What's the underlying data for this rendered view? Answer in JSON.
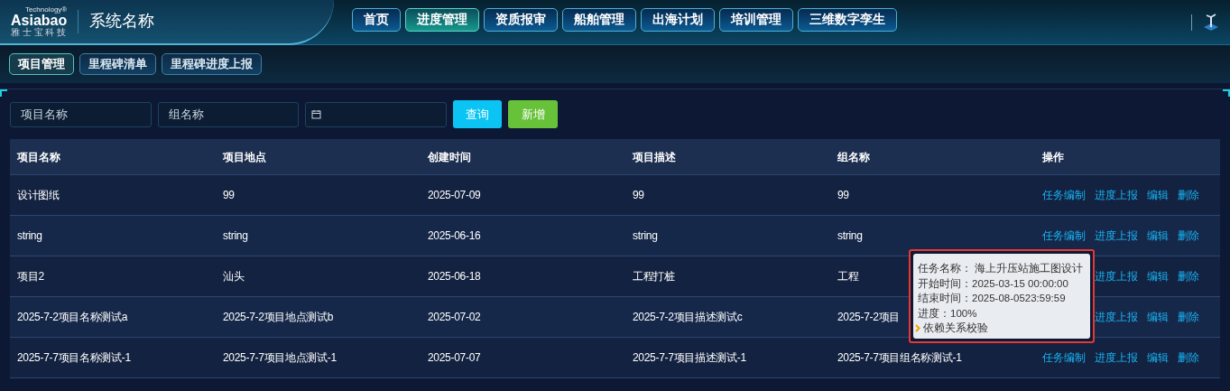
{
  "logo": {
    "brand": "Asiabao",
    "tagline": "Technology®",
    "subtitle": "雅 士 宝 科 技"
  },
  "system_name": "系统名称",
  "nav": [
    {
      "label": "首页",
      "selected": false
    },
    {
      "label": "进度管理",
      "selected": true
    },
    {
      "label": "资质报审",
      "selected": false
    },
    {
      "label": "船舶管理",
      "selected": false
    },
    {
      "label": "出海计划",
      "selected": false
    },
    {
      "label": "培训管理",
      "selected": false
    },
    {
      "label": "三维数字孪生",
      "selected": false
    }
  ],
  "sub_tabs": [
    {
      "label": "项目管理",
      "selected": true
    },
    {
      "label": "里程碑清单",
      "selected": false
    },
    {
      "label": "里程碑进度上报",
      "selected": false
    }
  ],
  "filters": {
    "project_name": {
      "placeholder": "项目名称"
    },
    "group_name": {
      "placeholder": "组名称"
    },
    "query_button": "查询",
    "add_button": "新增"
  },
  "table": {
    "columns": [
      "项目名称",
      "项目地点",
      "创建时间",
      "项目描述",
      "组名称",
      "操作"
    ],
    "rows": [
      {
        "cells": [
          "设计图纸",
          "99",
          "2025-07-09",
          "99",
          "99"
        ],
        "actions": [
          "任务编制",
          "进度上报",
          "编辑",
          "删除"
        ]
      },
      {
        "cells": [
          "string",
          "string",
          "2025-06-16",
          "string",
          "string"
        ],
        "actions": [
          "任务编制",
          "进度上报",
          "编辑",
          "删除"
        ]
      },
      {
        "cells": [
          "项目2",
          "汕头",
          "2025-06-18",
          "工程打桩",
          "工程"
        ],
        "actions": [
          "进度上报",
          "编辑",
          "删除"
        ]
      },
      {
        "cells": [
          "2025-7-2项目名称测试a",
          "2025-7-2项目地点测试b",
          "2025-07-02",
          "2025-7-2项目描述测试c",
          "2025-7-2项目"
        ],
        "actions": [
          "进度上报",
          "编辑",
          "删除"
        ]
      },
      {
        "cells": [
          "2025-7-7项目名称测试-1",
          "2025-7-7项目地点测试-1",
          "2025-07-07",
          "2025-7-7项目描述测试-1",
          "2025-7-7项目组名称测试-1"
        ],
        "actions": [
          "任务编制",
          "进度上报",
          "编辑",
          "删除"
        ]
      }
    ]
  },
  "tooltip": {
    "lines": [
      "任务名称： 海上升压站施工图设计",
      "开始时间：2025-03-15 00:00:00",
      "结束时间：2025-08-0523:59:59",
      "进度：100%"
    ],
    "link": "依赖关系校验"
  }
}
